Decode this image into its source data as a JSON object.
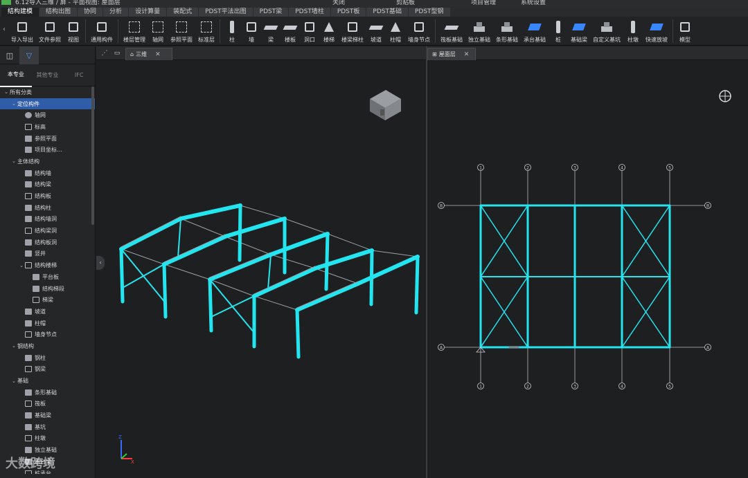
{
  "titlebar": {
    "title": "6.12导入三维 / 屏 - 平面视图: 屋面层",
    "items": [
      "关闭",
      "剪贴板",
      "项目管理",
      "系统设置"
    ]
  },
  "ribbon_tabs": [
    "结构建模",
    "结构出图",
    "协同",
    "分析",
    "设计算量",
    "装配式",
    "PDST平法出图",
    "PDST梁",
    "PDST墙柱",
    "PDST板",
    "PDST基础",
    "PDST型钢"
  ],
  "toolbar": {
    "groups": [
      [
        "导入导出",
        "文件参照",
        "视图"
      ],
      [
        "通用构件"
      ],
      [
        "楼层管理",
        "轴网",
        "参照平面",
        "标准层"
      ],
      [
        "柱",
        "墙",
        "梁",
        "楼板",
        "洞口",
        "楼梯",
        "楼梁梯柱",
        "坡道",
        "柱帽",
        "墙身节点"
      ],
      [
        "筏板基础",
        "独立基础",
        "条形基础",
        "承台基础",
        "桩",
        "基础梁",
        "自定义基坑",
        "柱墩",
        "快速放坡"
      ],
      [
        "模型"
      ]
    ]
  },
  "left_panel": {
    "tabs": [
      "本专业",
      "其他专业",
      "IFC"
    ],
    "tree": [
      {
        "label": "所有分类",
        "level": 0,
        "expand": "v"
      },
      {
        "label": "定位构件",
        "level": 1,
        "expand": "v",
        "selected": true
      },
      {
        "label": "轴网",
        "level": 2
      },
      {
        "label": "标高",
        "level": 2
      },
      {
        "label": "参照平面",
        "level": 2
      },
      {
        "label": "项目坐标…",
        "level": 2
      },
      {
        "label": "主体结构",
        "level": 1,
        "expand": "v"
      },
      {
        "label": "结构墙",
        "level": 2
      },
      {
        "label": "结构梁",
        "level": 2
      },
      {
        "label": "结构板",
        "level": 2
      },
      {
        "label": "结构柱",
        "level": 2
      },
      {
        "label": "结构墙洞",
        "level": 2
      },
      {
        "label": "结构梁洞",
        "level": 2
      },
      {
        "label": "结构板洞",
        "level": 2
      },
      {
        "label": "竖井",
        "level": 2
      },
      {
        "label": "结构楼梯",
        "level": 2,
        "expand": "v"
      },
      {
        "label": "平台板",
        "level": 3
      },
      {
        "label": "结构梯段",
        "level": 3
      },
      {
        "label": "梯梁",
        "level": 3
      },
      {
        "label": "坡道",
        "level": 2
      },
      {
        "label": "柱帽",
        "level": 2
      },
      {
        "label": "墙身节点",
        "level": 2
      },
      {
        "label": "钢结构",
        "level": 1,
        "expand": "v"
      },
      {
        "label": "钢柱",
        "level": 2
      },
      {
        "label": "钢梁",
        "level": 2
      },
      {
        "label": "基础",
        "level": 1,
        "expand": "v"
      },
      {
        "label": "条形基础",
        "level": 2
      },
      {
        "label": "筏板",
        "level": 2
      },
      {
        "label": "基础梁",
        "level": 2
      },
      {
        "label": "基坑",
        "level": 2
      },
      {
        "label": "柱墩",
        "level": 2
      },
      {
        "label": "独立基础",
        "level": 2
      },
      {
        "label": "承台梁",
        "level": 2
      },
      {
        "label": "桩承台",
        "level": 2
      }
    ]
  },
  "viewports": {
    "left_tab": "三维",
    "right_tab": "屋面层"
  },
  "plan": {
    "top_axes": [
      "1",
      "2",
      "3",
      "4",
      "5"
    ],
    "bottom_axes": [
      "1",
      "2",
      "3",
      "4",
      "5"
    ],
    "left_axes": [
      "B",
      "A"
    ],
    "right_axes": [
      "B",
      "A"
    ]
  },
  "watermark": "大数跨境",
  "colors": {
    "accent": "#2f5da8",
    "structure": "#22e5f0",
    "background": "#1e1f21"
  }
}
